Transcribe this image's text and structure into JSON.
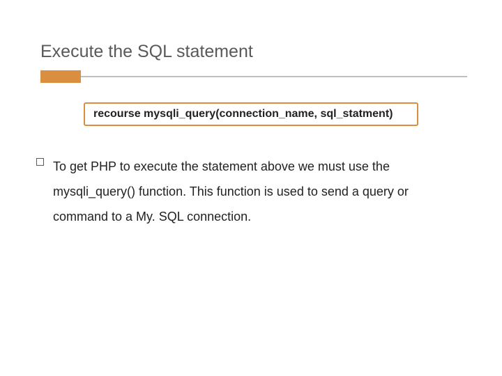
{
  "title": "Execute the SQL statement",
  "code": "recourse mysqli_query(connection_name, sql_statment)",
  "paragraph": "To get PHP to execute the statement above we must use the mysqli_query() function. This function is used to send a query or command to a My. SQL connection."
}
